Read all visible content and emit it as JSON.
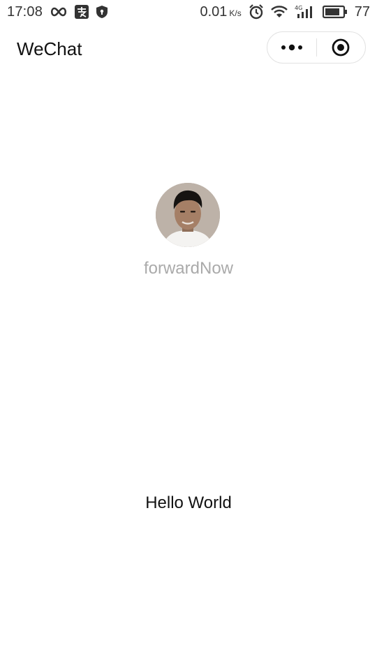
{
  "status_bar": {
    "time": "17:08",
    "network_speed": "0.01",
    "speed_unit": "K/s",
    "battery_level": "77",
    "icons": [
      "infinity-icon",
      "alipay-icon",
      "shield-icon",
      "alarm-icon",
      "wifi-icon",
      "signal-4g-icon",
      "battery-icon"
    ]
  },
  "navbar": {
    "title": "WeChat",
    "menu_icon": "more-dots-icon",
    "close_icon": "target-circle-icon"
  },
  "user": {
    "nickname": "forwardNow",
    "avatar_icon": "user-avatar"
  },
  "content": {
    "motto": "Hello World"
  },
  "colors": {
    "background": "#ffffff",
    "nickname": "#aaaaaa",
    "text": "#111111",
    "capsule_border": "#e2e2e2"
  }
}
